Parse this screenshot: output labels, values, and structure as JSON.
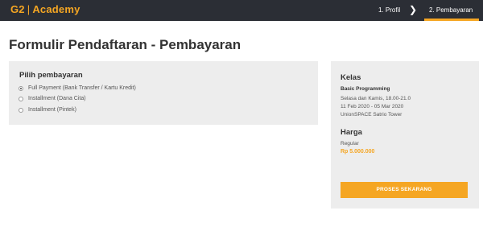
{
  "header": {
    "logo_main": "G2",
    "logo_sep": "|",
    "logo_sub": "Academy",
    "steps": [
      {
        "label": "1. Profil"
      },
      {
        "label": "2. Pembayaran"
      }
    ],
    "active_step": 2,
    "accent_color": "#f5a623",
    "background_color": "#2b2e35"
  },
  "page": {
    "title": "Formulir Pendaftaran - Pembayaran"
  },
  "payment": {
    "heading": "Pilih pembayaran",
    "options": [
      {
        "label": "Full Payment (Bank Transfer / Kartu Kredit)",
        "selected": true
      },
      {
        "label": "Installment (Dana Cita)",
        "selected": false
      },
      {
        "label": "Installment (Pintek)",
        "selected": false
      }
    ]
  },
  "summary": {
    "kelas_heading": "Kelas",
    "course_name": "Basic Programming",
    "schedule": "Selasa dan Kamis, 18.00-21.0",
    "dates": "11 Feb 2020 - 05 Mar 2020",
    "location": "UnionSPACE Satrio Tower",
    "harga_heading": "Harga",
    "price_type": "Regular",
    "price": "Rp 5.000.000",
    "cta_label": "PROSES SEKARANG"
  }
}
